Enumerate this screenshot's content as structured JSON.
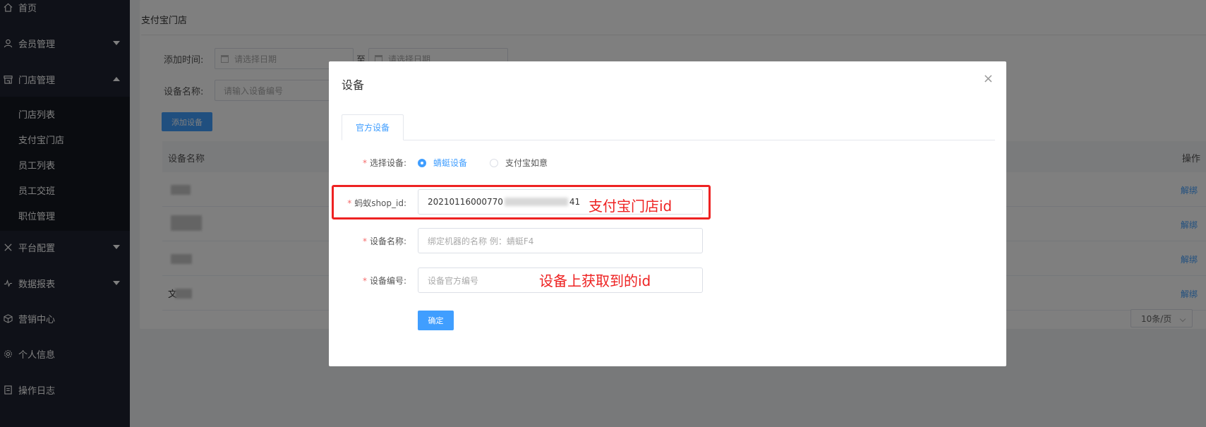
{
  "sidebar": {
    "items": [
      {
        "label": "首页",
        "icon": "home-icon"
      },
      {
        "label": "会员管理",
        "icon": "user-icon"
      },
      {
        "label": "门店管理",
        "icon": "store-icon"
      },
      {
        "label": "平台配置",
        "icon": "tools-icon"
      },
      {
        "label": "数据报表",
        "icon": "chart-icon"
      },
      {
        "label": "营销中心",
        "icon": "cube-icon"
      },
      {
        "label": "个人信息",
        "icon": "gear-icon"
      },
      {
        "label": "操作日志",
        "icon": "log-icon"
      }
    ],
    "submenu": [
      "门店列表",
      "支付宝门店",
      "员工列表",
      "员工交班",
      "职位管理"
    ]
  },
  "page": {
    "title": "支付宝门店",
    "filter": {
      "add_time_label": "添加时间:",
      "start_placeholder": "请选择日期",
      "range_sep": "至",
      "end_placeholder": "请选择日期",
      "device_name_label": "设备名称:",
      "device_name_placeholder": "请输入设备编号"
    },
    "add_button": "添加设备",
    "table": {
      "col_device_name": "设备名称",
      "col_action": "操作",
      "rows": [
        {
          "name_partial": "",
          "action": "解绑"
        },
        {
          "name_partial": "",
          "action": "解绑"
        },
        {
          "name_partial": "",
          "action": "解绑"
        },
        {
          "name_partial": "文",
          "action": "解绑"
        }
      ]
    },
    "pager": {
      "page_size": "10条/页"
    }
  },
  "dialog": {
    "title": "设备",
    "close": "×",
    "tab": "官方设备",
    "select_device_label": "选择设备:",
    "radio_options": [
      "蜻蜓设备",
      "支付宝如意"
    ],
    "selected_radio": 0,
    "shop_id_label": "蚂蚁shop_id:",
    "shop_id_value_start": "20210116000770",
    "shop_id_value_end": "41",
    "device_name_label": "设备名称:",
    "device_name_placeholder": "绑定机器的名称 例：蜻蜓F4",
    "device_no_label": "设备编号:",
    "device_no_placeholder": "设备官方编号",
    "confirm_button": "确定",
    "required_mark": "*"
  },
  "annotations": {
    "shop_id_note": "支付宝门店id",
    "device_id_note": "设备上获取到的id",
    "color": "#e22222"
  }
}
